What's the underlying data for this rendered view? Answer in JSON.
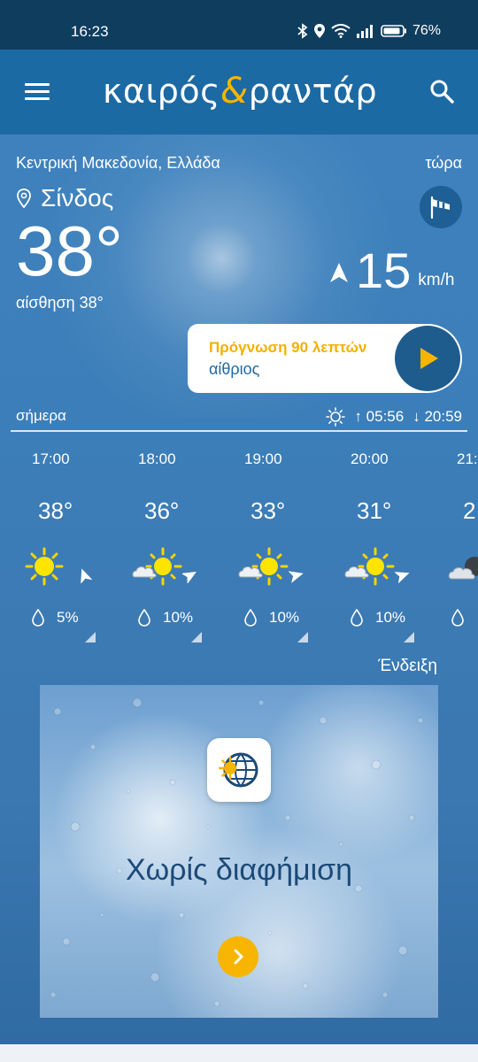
{
  "status_bar": {
    "time": "16:23",
    "battery": "76%"
  },
  "app": {
    "logo_left": "καιρός",
    "logo_amp": "&",
    "logo_right": "ραντάρ"
  },
  "current": {
    "region": "Κεντρική Μακεδονία, Ελλάδα",
    "now_label": "τώρα",
    "city": "Σίνδος",
    "temperature": "38°",
    "feels_like": "αίσθηση 38°",
    "wind_speed": "15",
    "wind_unit": "km/h"
  },
  "forecast_card": {
    "title": "Πρόγνωση 90 λεπτών",
    "subtitle": "αίθριος"
  },
  "today": {
    "label": "σήμερα",
    "sunrise": "05:56",
    "sunset": "20:59"
  },
  "hours": [
    {
      "time": "17:00",
      "temp": "38°",
      "icon": "sun-icon",
      "precip": "5%"
    },
    {
      "time": "18:00",
      "temp": "36°",
      "icon": "sun-cloud-icon",
      "precip": "10%"
    },
    {
      "time": "19:00",
      "temp": "33°",
      "icon": "sun-cloud-icon",
      "precip": "10%"
    },
    {
      "time": "20:00",
      "temp": "31°",
      "icon": "sun-cloud-icon",
      "precip": "10%"
    },
    {
      "time": "21:",
      "temp": "2",
      "icon": "moon-cloud-icon",
      "precip": ""
    }
  ],
  "ad": {
    "label": "Ένδειξη",
    "text": "Χωρίς διαφήμιση"
  },
  "colors": {
    "brand_blue": "#1c6aa4",
    "accent_yellow": "#f7b500"
  }
}
